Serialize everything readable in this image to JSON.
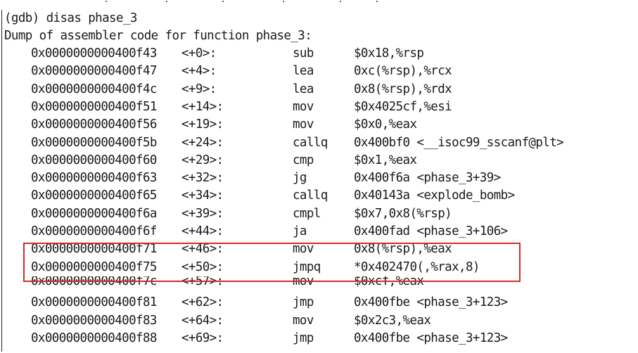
{
  "terminal": {
    "prompt_line": "(gdb) disas phase_3",
    "header_line": "Dump of assembler code for function phase_3:",
    "highlight_color": "#d42a2a",
    "rows": [
      {
        "addr": "0x0000000000400f43",
        "offset": "<+0>:",
        "mnemonic": "sub",
        "operands": "$0x18,%rsp"
      },
      {
        "addr": "0x0000000000400f47",
        "offset": "<+4>:",
        "mnemonic": "lea",
        "operands": "0xc(%rsp),%rcx"
      },
      {
        "addr": "0x0000000000400f4c",
        "offset": "<+9>:",
        "mnemonic": "lea",
        "operands": "0x8(%rsp),%rdx"
      },
      {
        "addr": "0x0000000000400f51",
        "offset": "<+14>:",
        "mnemonic": "mov",
        "operands": "$0x4025cf,%esi"
      },
      {
        "addr": "0x0000000000400f56",
        "offset": "<+19>:",
        "mnemonic": "mov",
        "operands": "$0x0,%eax"
      },
      {
        "addr": "0x0000000000400f5b",
        "offset": "<+24>:",
        "mnemonic": "callq",
        "operands": "0x400bf0 <__isoc99_sscanf@plt>"
      },
      {
        "addr": "0x0000000000400f60",
        "offset": "<+29>:",
        "mnemonic": "cmp",
        "operands": "$0x1,%eax"
      },
      {
        "addr": "0x0000000000400f63",
        "offset": "<+32>:",
        "mnemonic": "jg",
        "operands": "0x400f6a <phase_3+39>"
      },
      {
        "addr": "0x0000000000400f65",
        "offset": "<+34>:",
        "mnemonic": "callq",
        "operands": "0x40143a <explode_bomb>"
      },
      {
        "addr": "0x0000000000400f6a",
        "offset": "<+39>:",
        "mnemonic": "cmpl",
        "operands": "$0x7,0x8(%rsp)"
      },
      {
        "addr": "0x0000000000400f6f",
        "offset": "<+44>:",
        "mnemonic": "ja",
        "operands": "0x400fad <phase_3+106>"
      },
      {
        "addr": "0x0000000000400f71",
        "offset": "<+46>:",
        "mnemonic": "mov",
        "operands": "0x8(%rsp),%eax"
      },
      {
        "addr": "0x0000000000400f75",
        "offset": "<+50>:",
        "mnemonic": "jmpq",
        "operands": "*0x402470(,%rax,8)"
      },
      {
        "addr": "0x0000000000400f7c",
        "offset": "<+57>:",
        "mnemonic": "mov",
        "operands": "$0xcf,%eax"
      },
      {
        "addr": "0x0000000000400f81",
        "offset": "<+62>:",
        "mnemonic": "jmp",
        "operands": "0x400fbe <phase_3+123>"
      },
      {
        "addr": "0x0000000000400f83",
        "offset": "<+64>:",
        "mnemonic": "mov",
        "operands": "$0x2c3,%eax"
      },
      {
        "addr": "0x0000000000400f88",
        "offset": "<+69>:",
        "mnemonic": "jmp",
        "operands": "0x400fbe <phase_3+123>"
      }
    ]
  }
}
